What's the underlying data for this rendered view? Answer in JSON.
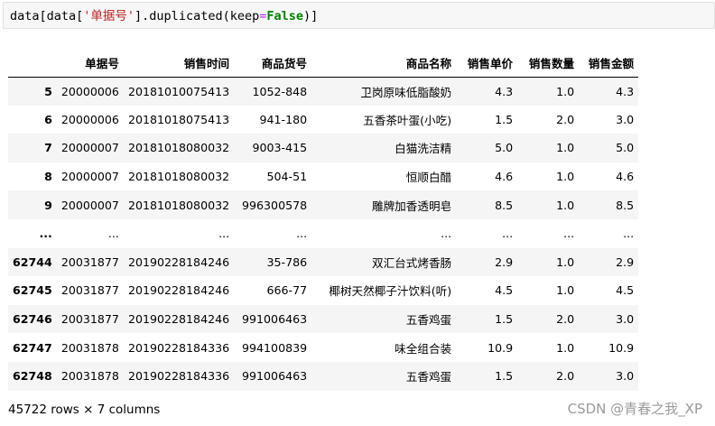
{
  "code": {
    "p1": "data[data[",
    "str": "'单据号'",
    "p2": "].duplicated(keep",
    "op": "=",
    "kw": "False",
    "p3": ")]"
  },
  "table": {
    "columns": [
      "",
      "单据号",
      "销售时间",
      "商品货号",
      "商品名称",
      "销售单价",
      "销售数量",
      "销售金额"
    ],
    "rows": [
      [
        "5",
        "20000006",
        "20181010075413",
        "1052-848",
        "卫岗原味低脂酸奶",
        "4.3",
        "1.0",
        "4.3"
      ],
      [
        "6",
        "20000006",
        "20181018075413",
        "941-180",
        "五香茶叶蛋(小吃)",
        "1.5",
        "2.0",
        "3.0"
      ],
      [
        "7",
        "20000007",
        "20181018080032",
        "9003-415",
        "白猫洗洁精",
        "5.0",
        "1.0",
        "5.0"
      ],
      [
        "8",
        "20000007",
        "20181018080032",
        "504-51",
        "恒顺白醋",
        "4.6",
        "1.0",
        "4.6"
      ],
      [
        "9",
        "20000007",
        "20181018080032",
        "996300578",
        "雕牌加香透明皂",
        "8.5",
        "1.0",
        "8.5"
      ],
      [
        "...",
        "...",
        "...",
        "...",
        "...",
        "...",
        "...",
        "..."
      ],
      [
        "62744",
        "20031877",
        "20190228184246",
        "35-786",
        "双汇台式烤香肠",
        "2.9",
        "1.0",
        "2.9"
      ],
      [
        "62745",
        "20031877",
        "20190228184246",
        "666-77",
        "椰树天然椰子汁饮料(听)",
        "4.5",
        "1.0",
        "4.5"
      ],
      [
        "62746",
        "20031877",
        "20190228184246",
        "991006463",
        "五香鸡蛋",
        "1.5",
        "2.0",
        "3.0"
      ],
      [
        "62747",
        "20031878",
        "20190228184336",
        "994100839",
        "味全组合装",
        "10.9",
        "1.0",
        "10.9"
      ],
      [
        "62748",
        "20031878",
        "20190228184336",
        "991006463",
        "五香鸡蛋",
        "1.5",
        "2.0",
        "3.0"
      ]
    ]
  },
  "summary": "45722 rows × 7 columns",
  "watermark": "CSDN @青春之我_XP"
}
